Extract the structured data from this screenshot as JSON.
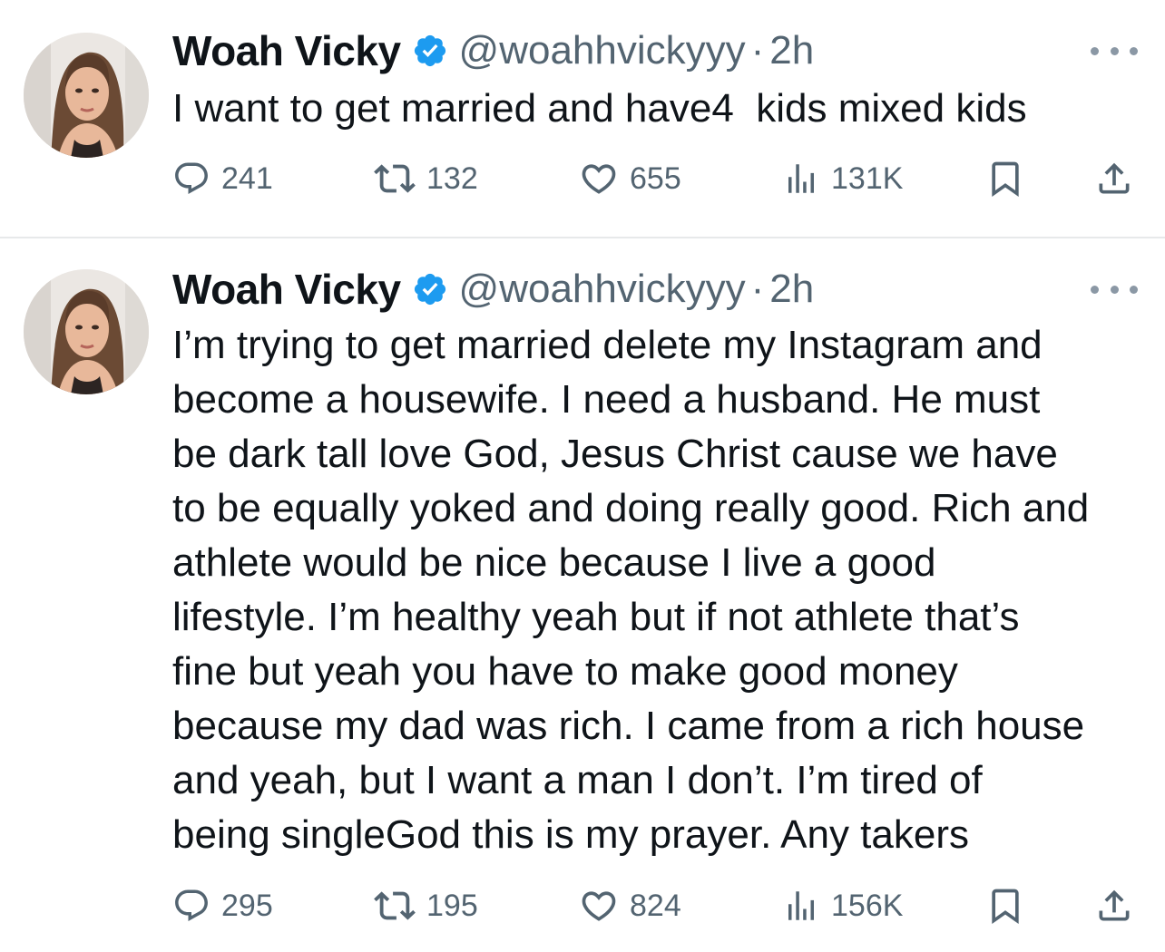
{
  "tweets": [
    {
      "name": "Woah Vicky",
      "handle": "@woahhvickyyy",
      "separator": "·",
      "time": "2h",
      "text": "I want to get married and have4  kids mixed kids",
      "stats": {
        "replies": "241",
        "retweets": "132",
        "likes": "655",
        "views": "131K"
      }
    },
    {
      "name": "Woah Vicky",
      "handle": "@woahhvickyyy",
      "separator": "·",
      "time": "2h",
      "text": "I’m trying to get married delete my Instagram and\nbecome a housewife. I need a husband. He must\nbe dark tall love God, Jesus Christ cause we have\nto be equally yoked and doing really good. Rich and\nathlete would be nice because I live a good\nlifestyle. I’m healthy yeah but if not athlete that’s\nfine but yeah you have to make good money\nbecause my dad was rich. I came from a rich house\nand yeah, but I want a man I don’t. I’m tired of\nbeing singleGod this is my prayer. Any takers",
      "stats": {
        "replies": "295",
        "retweets": "195",
        "likes": "824",
        "views": "156K"
      }
    }
  ],
  "icons": {
    "verified": "verified-badge-icon",
    "reply": "reply-icon",
    "retweet": "retweet-icon",
    "like": "heart-icon",
    "views": "views-icon",
    "bookmark": "bookmark-icon",
    "share": "share-icon",
    "more": "more-icon"
  },
  "colors": {
    "text": "#0f1419",
    "secondary": "#536471",
    "verified": "#1d9bf0",
    "divider": "#e7e9ea"
  }
}
